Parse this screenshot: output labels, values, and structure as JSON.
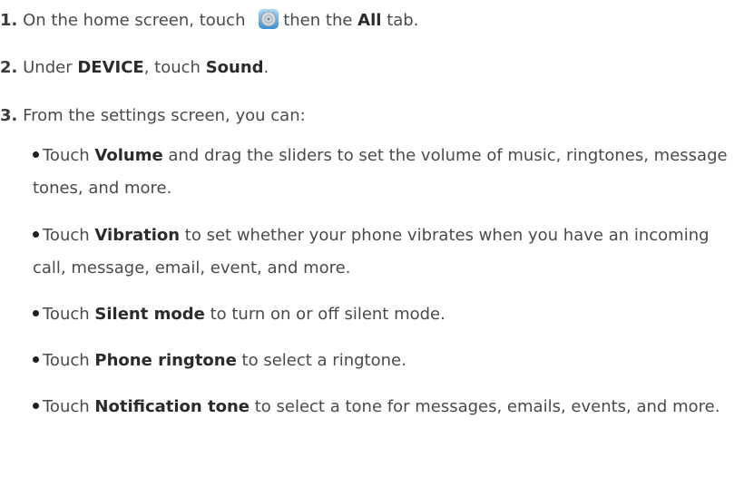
{
  "steps": [
    {
      "num": "1.",
      "parts": [
        "On the home screen, touch",
        "then the",
        "All",
        "tab."
      ],
      "icon": "settings-gear-icon"
    },
    {
      "num": "2.",
      "parts": [
        "Under",
        "DEVICE",
        ",",
        "touch",
        "Sound",
        "."
      ]
    },
    {
      "num": "3.",
      "text": "From the settings screen, you can:"
    }
  ],
  "bullets": [
    {
      "pre": "Touch",
      "bold": "Volume",
      "post": "and drag the sliders to set the volume of music, ringtones, message tones, and more."
    },
    {
      "pre": "Touch",
      "bold": "Vibration",
      "post": "to set whether your phone vibrates when you have an incoming call, message, email, event, and more."
    },
    {
      "pre": "Touch",
      "bold": "Silent mode",
      "post": "to turn on or off silent mode."
    },
    {
      "pre": "Touch",
      "bold": "Phone ringtone",
      "post": "to select a ringtone."
    },
    {
      "pre": "Touch",
      "bold": "Notification tone",
      "post": "to select a tone for messages, emails, events, and more."
    }
  ]
}
